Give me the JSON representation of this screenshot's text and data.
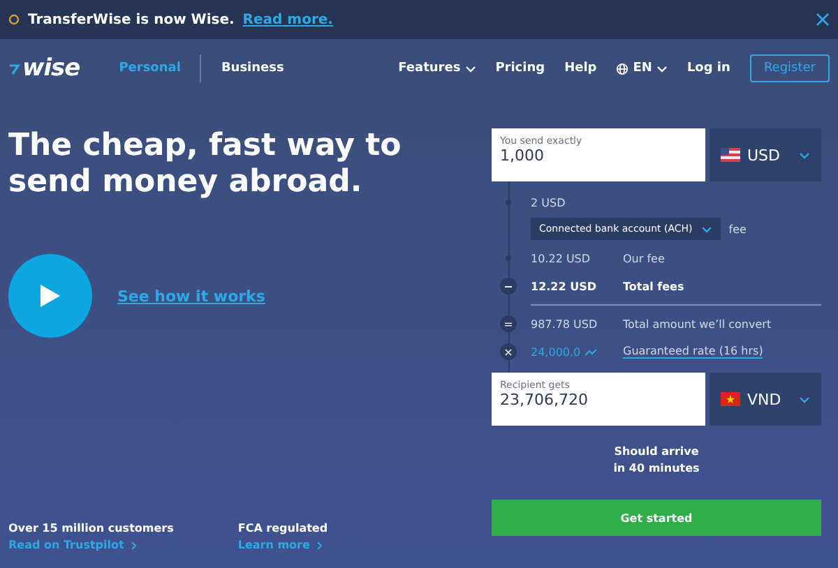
{
  "banner": {
    "text": "TransferWise is now Wise.",
    "link": "Read more."
  },
  "nav": {
    "logo": "wise",
    "segments": [
      {
        "label": "Personal",
        "selected": true
      },
      {
        "label": "Business",
        "selected": false
      }
    ],
    "links": [
      {
        "label": "Features",
        "kind": "menu"
      },
      {
        "label": "Pricing",
        "kind": "plain"
      },
      {
        "label": "Help",
        "kind": "plain"
      },
      {
        "label": "EN",
        "kind": "language"
      },
      {
        "label": "Log in",
        "kind": "plain"
      }
    ],
    "register": "Register"
  },
  "hero": {
    "headline": "The cheap, fast way to send money abroad.",
    "video_link": "See how it works",
    "stats": [
      {
        "title": "Over 15 million customers",
        "link": "Read on Trustpilot"
      },
      {
        "title": "FCA regulated",
        "link": "Learn more"
      }
    ]
  },
  "calculator": {
    "send": {
      "label": "You send exactly",
      "value": "1,000",
      "currency": "USD",
      "kind": "us"
    },
    "fees": [
      {
        "kind": "method",
        "amount": "2 USD",
        "method": "Connected bank account (ACH)",
        "suffix": "fee"
      },
      {
        "kind": "dot",
        "amount": "10.22 USD",
        "label": "Our fee"
      },
      {
        "kind": "total",
        "sign": "−",
        "amount": "12.22 USD",
        "label": "Total fees"
      },
      {
        "kind": "sign",
        "sign": "=",
        "amount": "987.78 USD",
        "label": "Total amount we’ll convert"
      },
      {
        "kind": "rate",
        "sign": "×",
        "amount": "24,000.0",
        "label": "Guaranteed rate (16 hrs)"
      }
    ],
    "receive": {
      "label": "Recipient gets",
      "value": "23,706,720",
      "currency": "VND",
      "kind": "vn"
    },
    "arrival": [
      "Should arrive",
      "in 40 minutes"
    ],
    "button": "Get started"
  }
}
